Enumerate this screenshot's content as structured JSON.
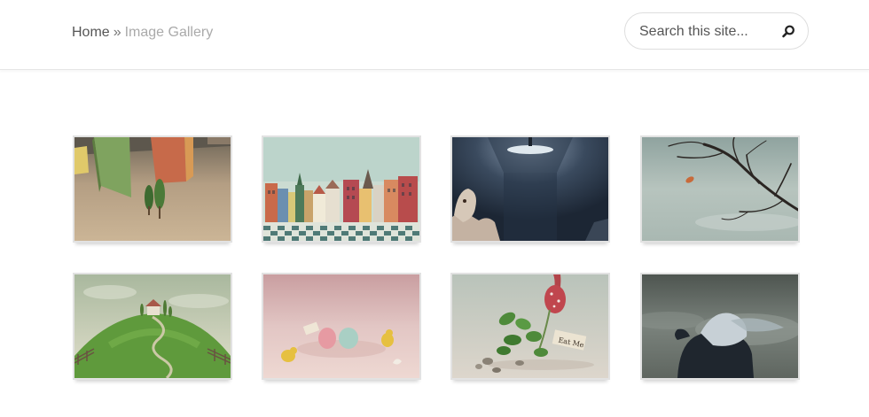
{
  "breadcrumb": {
    "home": "Home",
    "separator": "»",
    "current": "Image Gallery"
  },
  "search": {
    "placeholder": "Search this site...",
    "icon": "search-icon"
  },
  "gallery": {
    "images": [
      {
        "subject": "painted-towers-tree"
      },
      {
        "subject": "colorful-town-houses"
      },
      {
        "subject": "figure-under-lamp"
      },
      {
        "subject": "bare-tree-branch"
      },
      {
        "subject": "house-on-green-hill"
      },
      {
        "subject": "easter-eggs-chicks"
      },
      {
        "subject": "eat-me-mushroom"
      },
      {
        "subject": "rider-in-fog"
      }
    ]
  }
}
